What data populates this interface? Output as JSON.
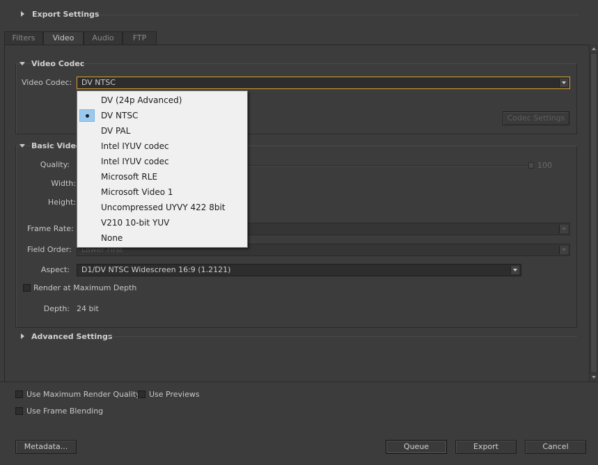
{
  "export_settings": {
    "title": "Export Settings"
  },
  "tabs": [
    {
      "label": "Filters"
    },
    {
      "label": "Video"
    },
    {
      "label": "Audio"
    },
    {
      "label": "FTP"
    }
  ],
  "video_codec_section": {
    "title": "Video Codec",
    "codec_label": "Video Codec:",
    "codec_value": "DV NTSC",
    "codec_settings_button": "Codec Settings"
  },
  "basic_video_section": {
    "title": "Basic Video",
    "quality_label": "Quality:",
    "quality_value": "100",
    "width_label": "Width:",
    "height_label": "Height:",
    "frame_rate_label": "Frame Rate:",
    "field_order_label": "Field Order:",
    "field_order_value": "Lower First",
    "aspect_label": "Aspect:",
    "aspect_value": "D1/DV NTSC Widescreen 16:9 (1.2121)",
    "render_max_depth_label": "Render at Maximum Depth",
    "depth_label": "Depth:",
    "depth_value": "24 bit"
  },
  "advanced_section": {
    "title": "Advanced Settings"
  },
  "codec_dropdown": {
    "items": [
      {
        "label": "DV (24p Advanced)"
      },
      {
        "label": "DV NTSC"
      },
      {
        "label": "DV PAL"
      },
      {
        "label": "Intel IYUV codec"
      },
      {
        "label": "Intel IYUV codec"
      },
      {
        "label": "Microsoft RLE"
      },
      {
        "label": "Microsoft Video 1"
      },
      {
        "label": "Uncompressed UYVY 422 8bit"
      },
      {
        "label": "V210 10-bit YUV"
      },
      {
        "label": "None"
      }
    ],
    "selected_index": 1
  },
  "bottom_options": {
    "use_max_render_quality": "Use Maximum Render Quality",
    "use_previews": "Use Previews",
    "use_frame_blending": "Use Frame Blending"
  },
  "buttons": {
    "metadata": "Metadata...",
    "queue": "Queue",
    "export": "Export",
    "cancel": "Cancel"
  },
  "colors": {
    "background": "#3c3c3c",
    "focus_border": "#d8a030",
    "selection": "#99c9ef"
  }
}
